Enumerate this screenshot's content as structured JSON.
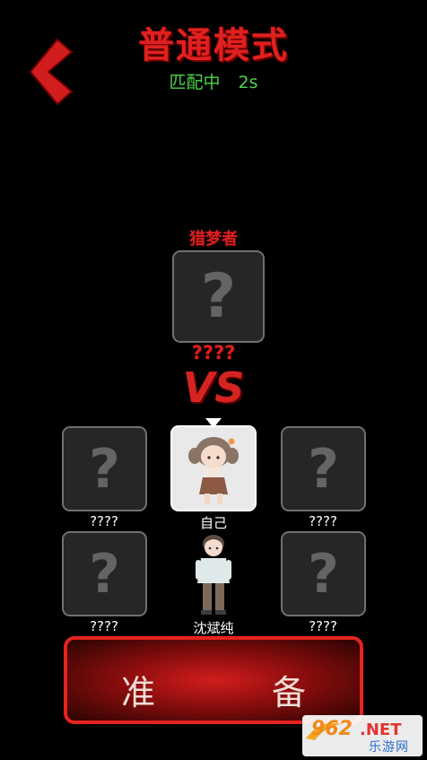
{
  "header": {
    "back_icon": "chevron-left-icon",
    "title": "普通模式",
    "status_label": "匹配中",
    "timer": "2s"
  },
  "opponent": {
    "role": "猎梦者",
    "name": "????",
    "placeholder_glyph": "?"
  },
  "versus": "VS",
  "players": [
    {
      "name": "????",
      "placeholder_glyph": "?"
    },
    {
      "name": "自己",
      "avatar": "girl-character-avatar",
      "is_self": true
    },
    {
      "name": "????",
      "placeholder_glyph": "?"
    },
    {
      "name": "????",
      "placeholder_glyph": "?"
    },
    {
      "name": "沈斌纯",
      "avatar": "boy-character-avatar"
    },
    {
      "name": "????",
      "placeholder_glyph": "?"
    }
  ],
  "ready_button": {
    "left_char": "准",
    "right_char": "备"
  },
  "watermark": {
    "brand": "962",
    "suffix": ".NET",
    "caption": "乐游网"
  },
  "colors": {
    "title_red": "#e0201f",
    "status_green": "#4ed44a",
    "slot_bg": "#262626",
    "button_red": "#e5231f"
  }
}
